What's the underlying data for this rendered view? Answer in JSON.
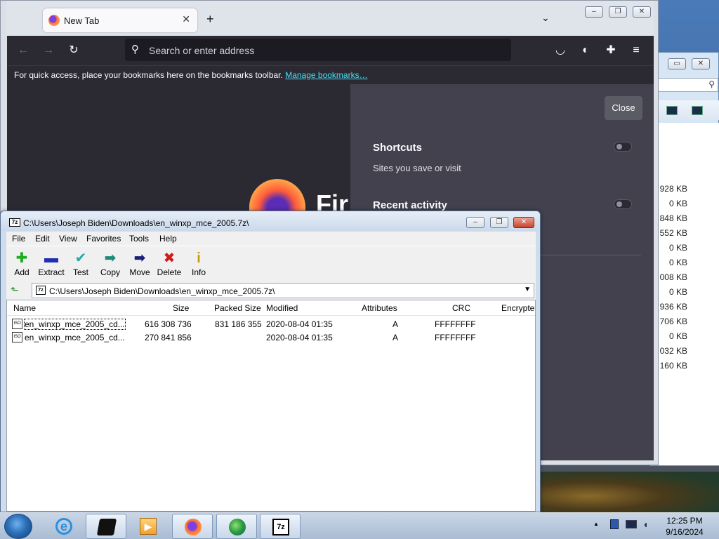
{
  "explorer_bg": {
    "sizes": [
      "928 KB",
      "0 KB",
      "848 KB",
      "552 KB",
      "0 KB",
      "0 KB",
      "008 KB",
      "0 KB",
      "936 KB",
      "706 KB",
      "0 KB",
      "032 KB",
      "160 KB"
    ]
  },
  "firefox": {
    "tab_title": "New Tab",
    "tab_close": "✕",
    "new_tab": "+",
    "list_tabs": "⌄",
    "url_placeholder": "Search or enter address",
    "bookmarks_text": "For quick access, place your bookmarks here on the bookmarks toolbar.",
    "bookmarks_link": "Manage bookmarks…",
    "brand_text": "Fir",
    "panel": {
      "close_label": "Close",
      "shortcuts_title": "Shortcuts",
      "shortcuts_sub": "Sites you save or visit",
      "recent_title": "Recent activity"
    }
  },
  "sevenzip": {
    "title": "C:\\Users\\Joseph Biden\\Downloads\\en_winxp_mce_2005.7z\\",
    "menu": [
      "File",
      "Edit",
      "View",
      "Favorites",
      "Tools",
      "Help"
    ],
    "toolbar": [
      {
        "label": "Add",
        "icon": "plus-icon",
        "color": "#22aa22",
        "glyph": "✚"
      },
      {
        "label": "Extract",
        "icon": "minus-icon",
        "color": "#1e2fb0",
        "glyph": "▬"
      },
      {
        "label": "Test",
        "icon": "check-icon",
        "color": "#2aa8a8",
        "glyph": "✔"
      },
      {
        "label": "Copy",
        "icon": "copy-arrow-icon",
        "color": "#1e8a7a",
        "glyph": "➡"
      },
      {
        "label": "Move",
        "icon": "move-arrow-icon",
        "color": "#1a1f7a",
        "glyph": "➡"
      },
      {
        "label": "Delete",
        "icon": "delete-x-icon",
        "color": "#d21a1a",
        "glyph": "✖"
      },
      {
        "label": "Info",
        "icon": "info-icon",
        "color": "#c8a000",
        "glyph": "i"
      }
    ],
    "address": "C:\\Users\\Joseph Biden\\Downloads\\en_winxp_mce_2005.7z\\",
    "columns": [
      "Name",
      "Size",
      "Packed Size",
      "Modified",
      "Attributes",
      "CRC",
      "Encrypte"
    ],
    "files": [
      {
        "name": "en_winxp_mce_2005_cd...",
        "size": "616 308 736",
        "packed": "831 186 355",
        "modified": "2020-08-04 01:35",
        "attr": "A",
        "crc": "FFFFFFFF"
      },
      {
        "name": "en_winxp_mce_2005_cd...",
        "size": "270 841 856",
        "packed": "",
        "modified": "2020-08-04 01:35",
        "attr": "A",
        "crc": "FFFFFFFF"
      }
    ]
  },
  "taskbar": {
    "time": "12:25 PM",
    "date": "9/16/2024",
    "tray_expand": "▲"
  }
}
